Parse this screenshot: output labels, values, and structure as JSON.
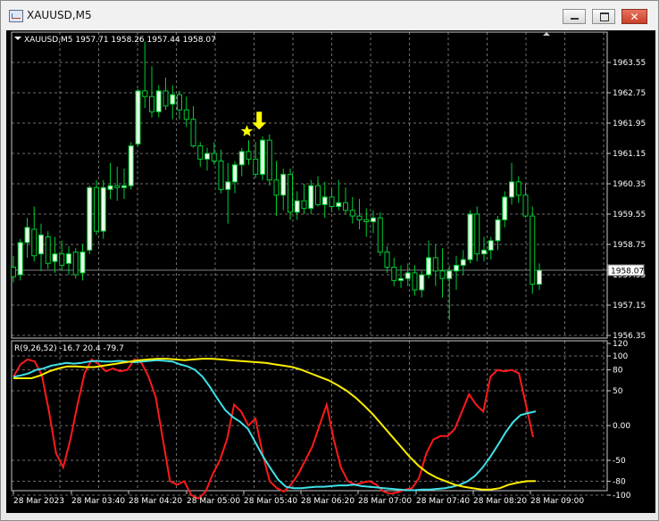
{
  "window": {
    "title": "XAUUSD,M5",
    "minimize_icon": "minimize-icon",
    "maximize_icon": "maximize-icon",
    "close_icon": "close-icon"
  },
  "chart": {
    "info_label": "XAUUSD,M5  1957.71 1958.26 1957.44 1958.07",
    "current_price": "1958.07",
    "price_ticks": [
      "1963.55",
      "1962.75",
      "1961.95",
      "1961.15",
      "1960.35",
      "1959.55",
      "1958.75",
      "1957.95",
      "1957.15",
      "1956.35"
    ],
    "time_ticks": [
      "28 Mar 2023",
      "28 Mar 03:40",
      "28 Mar 04:20",
      "28 Mar 05:00",
      "28 Mar 05:40",
      "28 Mar 06:20",
      "28 Mar 07:00",
      "28 Mar 07:40",
      "28 Mar 08:20",
      "28 Mar 09:00"
    ],
    "signal_icons": [
      "down-arrow-icon",
      "star-icon"
    ],
    "colors": {
      "background": "#000000",
      "grid": "#c8c8c8",
      "bull": "#e8ffe8",
      "bear": "#00cc33",
      "signal": "#ffff00"
    }
  },
  "indicator": {
    "label": "R(9,26,52) -16.7 20.4 -79.7",
    "scale_ticks": [
      "120",
      "100",
      "80",
      "50",
      "0.00",
      "-50",
      "-80",
      "-100"
    ],
    "colors": {
      "line1": "#ff1a1a",
      "line2": "#40e0e8",
      "line3": "#ffee00"
    }
  },
  "chart_data": {
    "type": "candlestick",
    "symbol": "XAUUSD",
    "timeframe": "M5",
    "last_quote": {
      "open": 1957.71,
      "high": 1958.26,
      "low": 1957.44,
      "close": 1958.07
    },
    "ylim": [
      1956.35,
      1964.2
    ],
    "candles": [
      {
        "o": 1958.15,
        "h": 1958.45,
        "l": 1957.75,
        "c": 1957.9
      },
      {
        "o": 1957.95,
        "h": 1958.9,
        "l": 1957.8,
        "c": 1958.8
      },
      {
        "o": 1958.8,
        "h": 1959.45,
        "l": 1958.4,
        "c": 1959.2
      },
      {
        "o": 1959.15,
        "h": 1959.75,
        "l": 1958.3,
        "c": 1958.45
      },
      {
        "o": 1958.5,
        "h": 1959.3,
        "l": 1958.05,
        "c": 1959.0
      },
      {
        "o": 1958.95,
        "h": 1959.1,
        "l": 1958.1,
        "c": 1958.25
      },
      {
        "o": 1958.3,
        "h": 1958.95,
        "l": 1958.0,
        "c": 1958.5
      },
      {
        "o": 1958.5,
        "h": 1958.85,
        "l": 1958.05,
        "c": 1958.2
      },
      {
        "o": 1958.25,
        "h": 1958.7,
        "l": 1957.95,
        "c": 1958.5
      },
      {
        "o": 1958.55,
        "h": 1958.65,
        "l": 1957.85,
        "c": 1957.95
      },
      {
        "o": 1958.0,
        "h": 1958.75,
        "l": 1957.8,
        "c": 1958.55
      },
      {
        "o": 1958.6,
        "h": 1960.3,
        "l": 1958.5,
        "c": 1960.25
      },
      {
        "o": 1960.25,
        "h": 1960.45,
        "l": 1959.0,
        "c": 1959.1
      },
      {
        "o": 1959.1,
        "h": 1960.45,
        "l": 1958.9,
        "c": 1960.25
      },
      {
        "o": 1960.2,
        "h": 1960.9,
        "l": 1959.95,
        "c": 1960.3
      },
      {
        "o": 1960.3,
        "h": 1960.8,
        "l": 1959.9,
        "c": 1960.25
      },
      {
        "o": 1960.25,
        "h": 1960.75,
        "l": 1959.95,
        "c": 1960.3
      },
      {
        "o": 1960.3,
        "h": 1961.45,
        "l": 1960.2,
        "c": 1961.35
      },
      {
        "o": 1961.4,
        "h": 1962.85,
        "l": 1961.35,
        "c": 1962.8
      },
      {
        "o": 1962.8,
        "h": 1964.1,
        "l": 1962.35,
        "c": 1962.65
      },
      {
        "o": 1962.65,
        "h": 1963.45,
        "l": 1962.1,
        "c": 1962.25
      },
      {
        "o": 1962.25,
        "h": 1962.95,
        "l": 1962.1,
        "c": 1962.8
      },
      {
        "o": 1962.8,
        "h": 1963.15,
        "l": 1962.3,
        "c": 1962.4
      },
      {
        "o": 1962.45,
        "h": 1962.95,
        "l": 1962.05,
        "c": 1962.7
      },
      {
        "o": 1962.7,
        "h": 1962.8,
        "l": 1962.05,
        "c": 1962.3
      },
      {
        "o": 1962.3,
        "h": 1962.65,
        "l": 1961.85,
        "c": 1962.05
      },
      {
        "o": 1962.05,
        "h": 1962.4,
        "l": 1961.3,
        "c": 1961.35
      },
      {
        "o": 1961.35,
        "h": 1961.45,
        "l": 1960.8,
        "c": 1961.0
      },
      {
        "o": 1961.0,
        "h": 1961.3,
        "l": 1960.7,
        "c": 1961.15
      },
      {
        "o": 1961.15,
        "h": 1961.45,
        "l": 1960.85,
        "c": 1960.95
      },
      {
        "o": 1960.95,
        "h": 1961.25,
        "l": 1960.1,
        "c": 1960.2
      },
      {
        "o": 1960.2,
        "h": 1960.9,
        "l": 1959.3,
        "c": 1960.4
      },
      {
        "o": 1960.4,
        "h": 1960.95,
        "l": 1960.1,
        "c": 1960.85
      },
      {
        "o": 1960.85,
        "h": 1961.3,
        "l": 1960.55,
        "c": 1961.2
      },
      {
        "o": 1961.2,
        "h": 1961.5,
        "l": 1960.85,
        "c": 1961.0
      },
      {
        "o": 1961.0,
        "h": 1961.45,
        "l": 1960.5,
        "c": 1960.6
      },
      {
        "o": 1960.6,
        "h": 1961.6,
        "l": 1960.45,
        "c": 1961.5
      },
      {
        "o": 1961.5,
        "h": 1961.65,
        "l": 1960.3,
        "c": 1960.45
      },
      {
        "o": 1960.45,
        "h": 1960.95,
        "l": 1959.5,
        "c": 1960.05
      },
      {
        "o": 1960.05,
        "h": 1960.75,
        "l": 1959.65,
        "c": 1960.6
      },
      {
        "o": 1960.6,
        "h": 1960.75,
        "l": 1959.4,
        "c": 1959.6
      },
      {
        "o": 1959.6,
        "h": 1960.15,
        "l": 1959.4,
        "c": 1959.9
      },
      {
        "o": 1959.9,
        "h": 1960.35,
        "l": 1959.55,
        "c": 1959.7
      },
      {
        "o": 1959.7,
        "h": 1960.45,
        "l": 1959.55,
        "c": 1960.3
      },
      {
        "o": 1960.3,
        "h": 1960.55,
        "l": 1959.75,
        "c": 1959.8
      },
      {
        "o": 1959.8,
        "h": 1960.4,
        "l": 1959.45,
        "c": 1960.0
      },
      {
        "o": 1960.0,
        "h": 1960.25,
        "l": 1959.6,
        "c": 1959.75
      },
      {
        "o": 1959.75,
        "h": 1960.45,
        "l": 1959.65,
        "c": 1959.85
      },
      {
        "o": 1959.85,
        "h": 1960.25,
        "l": 1959.55,
        "c": 1959.65
      },
      {
        "o": 1959.65,
        "h": 1960.0,
        "l": 1959.3,
        "c": 1959.5
      },
      {
        "o": 1959.5,
        "h": 1959.95,
        "l": 1959.15,
        "c": 1959.4
      },
      {
        "o": 1959.4,
        "h": 1959.7,
        "l": 1958.95,
        "c": 1959.35
      },
      {
        "o": 1959.35,
        "h": 1959.65,
        "l": 1959.05,
        "c": 1959.45
      },
      {
        "o": 1959.45,
        "h": 1959.6,
        "l": 1958.45,
        "c": 1958.55
      },
      {
        "o": 1958.55,
        "h": 1958.7,
        "l": 1958.0,
        "c": 1958.15
      },
      {
        "o": 1958.15,
        "h": 1958.4,
        "l": 1957.65,
        "c": 1957.8
      },
      {
        "o": 1957.8,
        "h": 1958.2,
        "l": 1957.6,
        "c": 1957.85
      },
      {
        "o": 1957.85,
        "h": 1958.25,
        "l": 1957.65,
        "c": 1958.0
      },
      {
        "o": 1958.0,
        "h": 1958.2,
        "l": 1957.4,
        "c": 1957.55
      },
      {
        "o": 1957.55,
        "h": 1958.05,
        "l": 1957.35,
        "c": 1957.95
      },
      {
        "o": 1957.95,
        "h": 1958.85,
        "l": 1957.85,
        "c": 1958.4
      },
      {
        "o": 1958.4,
        "h": 1958.75,
        "l": 1957.65,
        "c": 1958.05
      },
      {
        "o": 1958.05,
        "h": 1958.65,
        "l": 1957.35,
        "c": 1957.85
      },
      {
        "o": 1957.85,
        "h": 1958.2,
        "l": 1956.75,
        "c": 1958.05
      },
      {
        "o": 1958.05,
        "h": 1958.45,
        "l": 1957.55,
        "c": 1958.2
      },
      {
        "o": 1958.2,
        "h": 1958.6,
        "l": 1957.95,
        "c": 1958.35
      },
      {
        "o": 1958.35,
        "h": 1959.65,
        "l": 1958.25,
        "c": 1959.55
      },
      {
        "o": 1959.55,
        "h": 1959.75,
        "l": 1958.3,
        "c": 1958.5
      },
      {
        "o": 1958.5,
        "h": 1958.95,
        "l": 1958.3,
        "c": 1958.6
      },
      {
        "o": 1958.6,
        "h": 1958.95,
        "l": 1958.35,
        "c": 1958.85
      },
      {
        "o": 1958.85,
        "h": 1959.5,
        "l": 1958.6,
        "c": 1959.4
      },
      {
        "o": 1959.4,
        "h": 1960.15,
        "l": 1959.2,
        "c": 1960.0
      },
      {
        "o": 1960.0,
        "h": 1960.9,
        "l": 1959.8,
        "c": 1960.4
      },
      {
        "o": 1960.4,
        "h": 1960.55,
        "l": 1959.85,
        "c": 1960.05
      },
      {
        "o": 1960.05,
        "h": 1960.35,
        "l": 1959.45,
        "c": 1959.5
      },
      {
        "o": 1959.5,
        "h": 1959.75,
        "l": 1957.45,
        "c": 1957.7
      },
      {
        "o": 1957.7,
        "h": 1958.25,
        "l": 1957.55,
        "c": 1958.07
      }
    ],
    "signals": [
      {
        "index": 35,
        "type": "down-arrow"
      },
      {
        "index": 34,
        "type": "star"
      }
    ],
    "oscillator": {
      "label": "R(9,26,52)",
      "ylim": [
        -110,
        120
      ],
      "last_values": [
        -16.7,
        20.4,
        -79.7
      ],
      "series": [
        {
          "color": "#ff1a1a",
          "values": [
            70,
            88,
            95,
            92,
            72,
            20,
            -40,
            -60,
            -20,
            30,
            75,
            95,
            88,
            78,
            82,
            78,
            80,
            95,
            90,
            70,
            40,
            -20,
            -80,
            -85,
            -80,
            -100,
            -105,
            -95,
            -70,
            -50,
            -20,
            30,
            20,
            0,
            10,
            -40,
            -80,
            -90,
            -95,
            -85,
            -70,
            -50,
            -30,
            0,
            30,
            -20,
            -60,
            -80,
            -85,
            -82,
            -80,
            -85,
            -95,
            -98,
            -96,
            -92,
            -90,
            -75,
            -40,
            -20,
            -15,
            -15,
            -5,
            20,
            45,
            30,
            20,
            70,
            80,
            78,
            80,
            75,
            30,
            -16.7
          ]
        },
        {
          "color": "#40e0e8",
          "values": [
            70,
            72,
            75,
            80,
            82,
            86,
            88,
            90,
            89,
            90,
            92,
            93,
            92,
            92,
            93,
            92,
            91,
            92,
            93,
            94,
            93,
            92,
            88,
            85,
            80,
            70,
            55,
            38,
            22,
            12,
            5,
            -5,
            -25,
            -45,
            -62,
            -78,
            -88,
            -90,
            -90,
            -89,
            -88,
            -88,
            -87,
            -86,
            -86,
            -85,
            -87,
            -88,
            -89,
            -90,
            -91,
            -92,
            -93,
            -93,
            -92,
            -92,
            -91,
            -90,
            -88,
            -85,
            -80,
            -72,
            -60,
            -45,
            -28,
            -10,
            5,
            15,
            18,
            20.4
          ]
        },
        {
          "color": "#ffee00",
          "values": [
            68,
            68,
            68,
            72,
            78,
            82,
            85,
            85,
            84,
            84,
            86,
            88,
            90,
            92,
            94,
            95,
            96,
            96,
            95,
            94,
            95,
            96,
            96,
            95,
            94,
            93,
            92,
            91,
            90,
            88,
            86,
            84,
            80,
            75,
            70,
            65,
            58,
            50,
            40,
            28,
            15,
            0,
            -15,
            -30,
            -45,
            -58,
            -68,
            -75,
            -80,
            -85,
            -88,
            -90,
            -92,
            -92,
            -90,
            -85,
            -82,
            -80,
            -79.7
          ]
        }
      ]
    }
  }
}
